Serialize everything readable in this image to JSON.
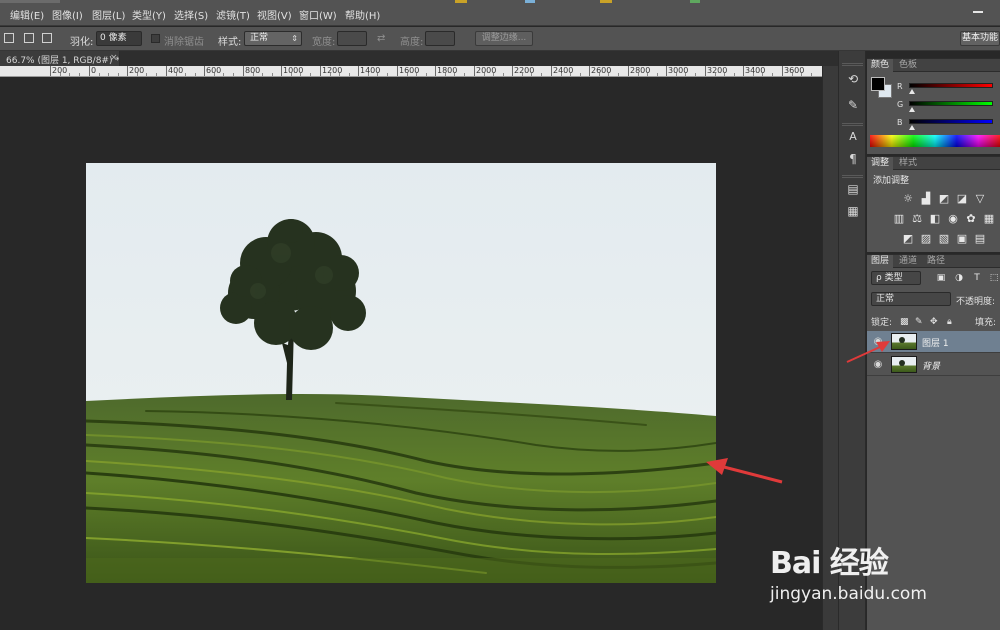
{
  "menubar": {
    "items": [
      "编辑(E)",
      "图像(I)",
      "图层(L)",
      "类型(Y)",
      "选择(S)",
      "滤镜(T)",
      "视图(V)",
      "窗口(W)",
      "帮助(H)"
    ]
  },
  "options": {
    "feather_label": "羽化:",
    "feather_value": "0 像素",
    "antialias_label": "消除锯齿",
    "style_label": "样式:",
    "style_value": "正常",
    "width_label": "宽度:",
    "height_label": "高度:",
    "refine_edge": "调整边缘...",
    "workspace": "基本功能"
  },
  "document": {
    "tab_title": "66.7% (图层 1, RGB/8#) *",
    "close_glyph": "×"
  },
  "ruler": {
    "labels": [
      "200",
      "0",
      "200",
      "400",
      "600",
      "800",
      "1000",
      "1200",
      "1400",
      "1600",
      "1800",
      "2000",
      "2200",
      "2400",
      "2600",
      "2800",
      "3000",
      "3200",
      "3400",
      "3600"
    ]
  },
  "panels": {
    "color_tabs": [
      "颜色",
      "色板"
    ],
    "channels": [
      "R",
      "G",
      "B"
    ],
    "adjust_tabs": [
      "调整",
      "样式"
    ],
    "adjust_title": "添加调整",
    "layer_tabs": [
      "图层",
      "通道",
      "路径"
    ],
    "filter_kind": "ρ 类型",
    "blend_mode": "正常",
    "opacity_label": "不透明度:",
    "lock_label": "锁定:",
    "fill_label": "填充:",
    "layers": [
      {
        "name": "图层 1",
        "selected": true
      },
      {
        "name": "背景",
        "selected": false
      }
    ]
  },
  "watermark": {
    "brand": "Bai 经验",
    "url": "jingyan.baidu.com"
  },
  "colors": {
    "arrow": "#e03a3a",
    "selected_layer": "#6f8091",
    "chrome": "#535353"
  }
}
